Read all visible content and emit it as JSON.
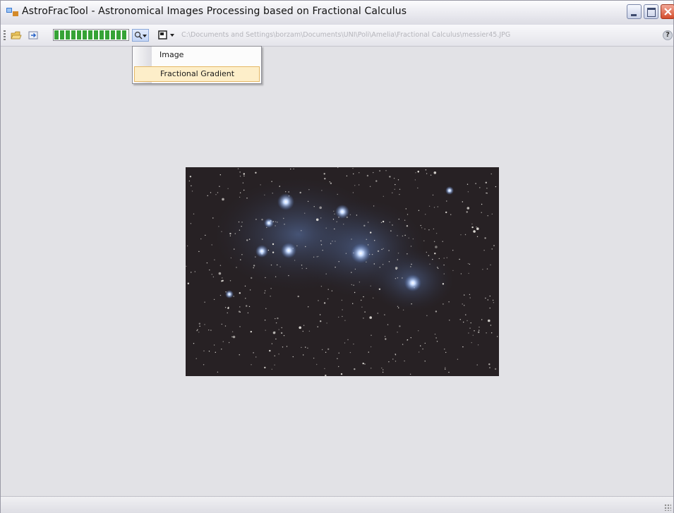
{
  "window": {
    "title": "AstroFracTool - Astronomical Images Processing based on Fractional Calculus"
  },
  "toolbar": {
    "progress_value": 1.0,
    "file_path": "C:\\Documents and Settings\\borzam\\Documents\\UNI\\Poli\\Amelia\\Fractional Calculus\\messier45.JPG",
    "help_label": "?"
  },
  "dropdown_menu": {
    "items": [
      {
        "label": "Image"
      },
      {
        "label": "Fractional Gradient"
      }
    ]
  },
  "colors": {
    "highlight": "#fdeec9",
    "progress": "#36a336"
  },
  "icons": [
    "app-icon",
    "open-folder-icon",
    "export-icon",
    "zoom-icon",
    "view-mode-icon",
    "help-icon"
  ]
}
